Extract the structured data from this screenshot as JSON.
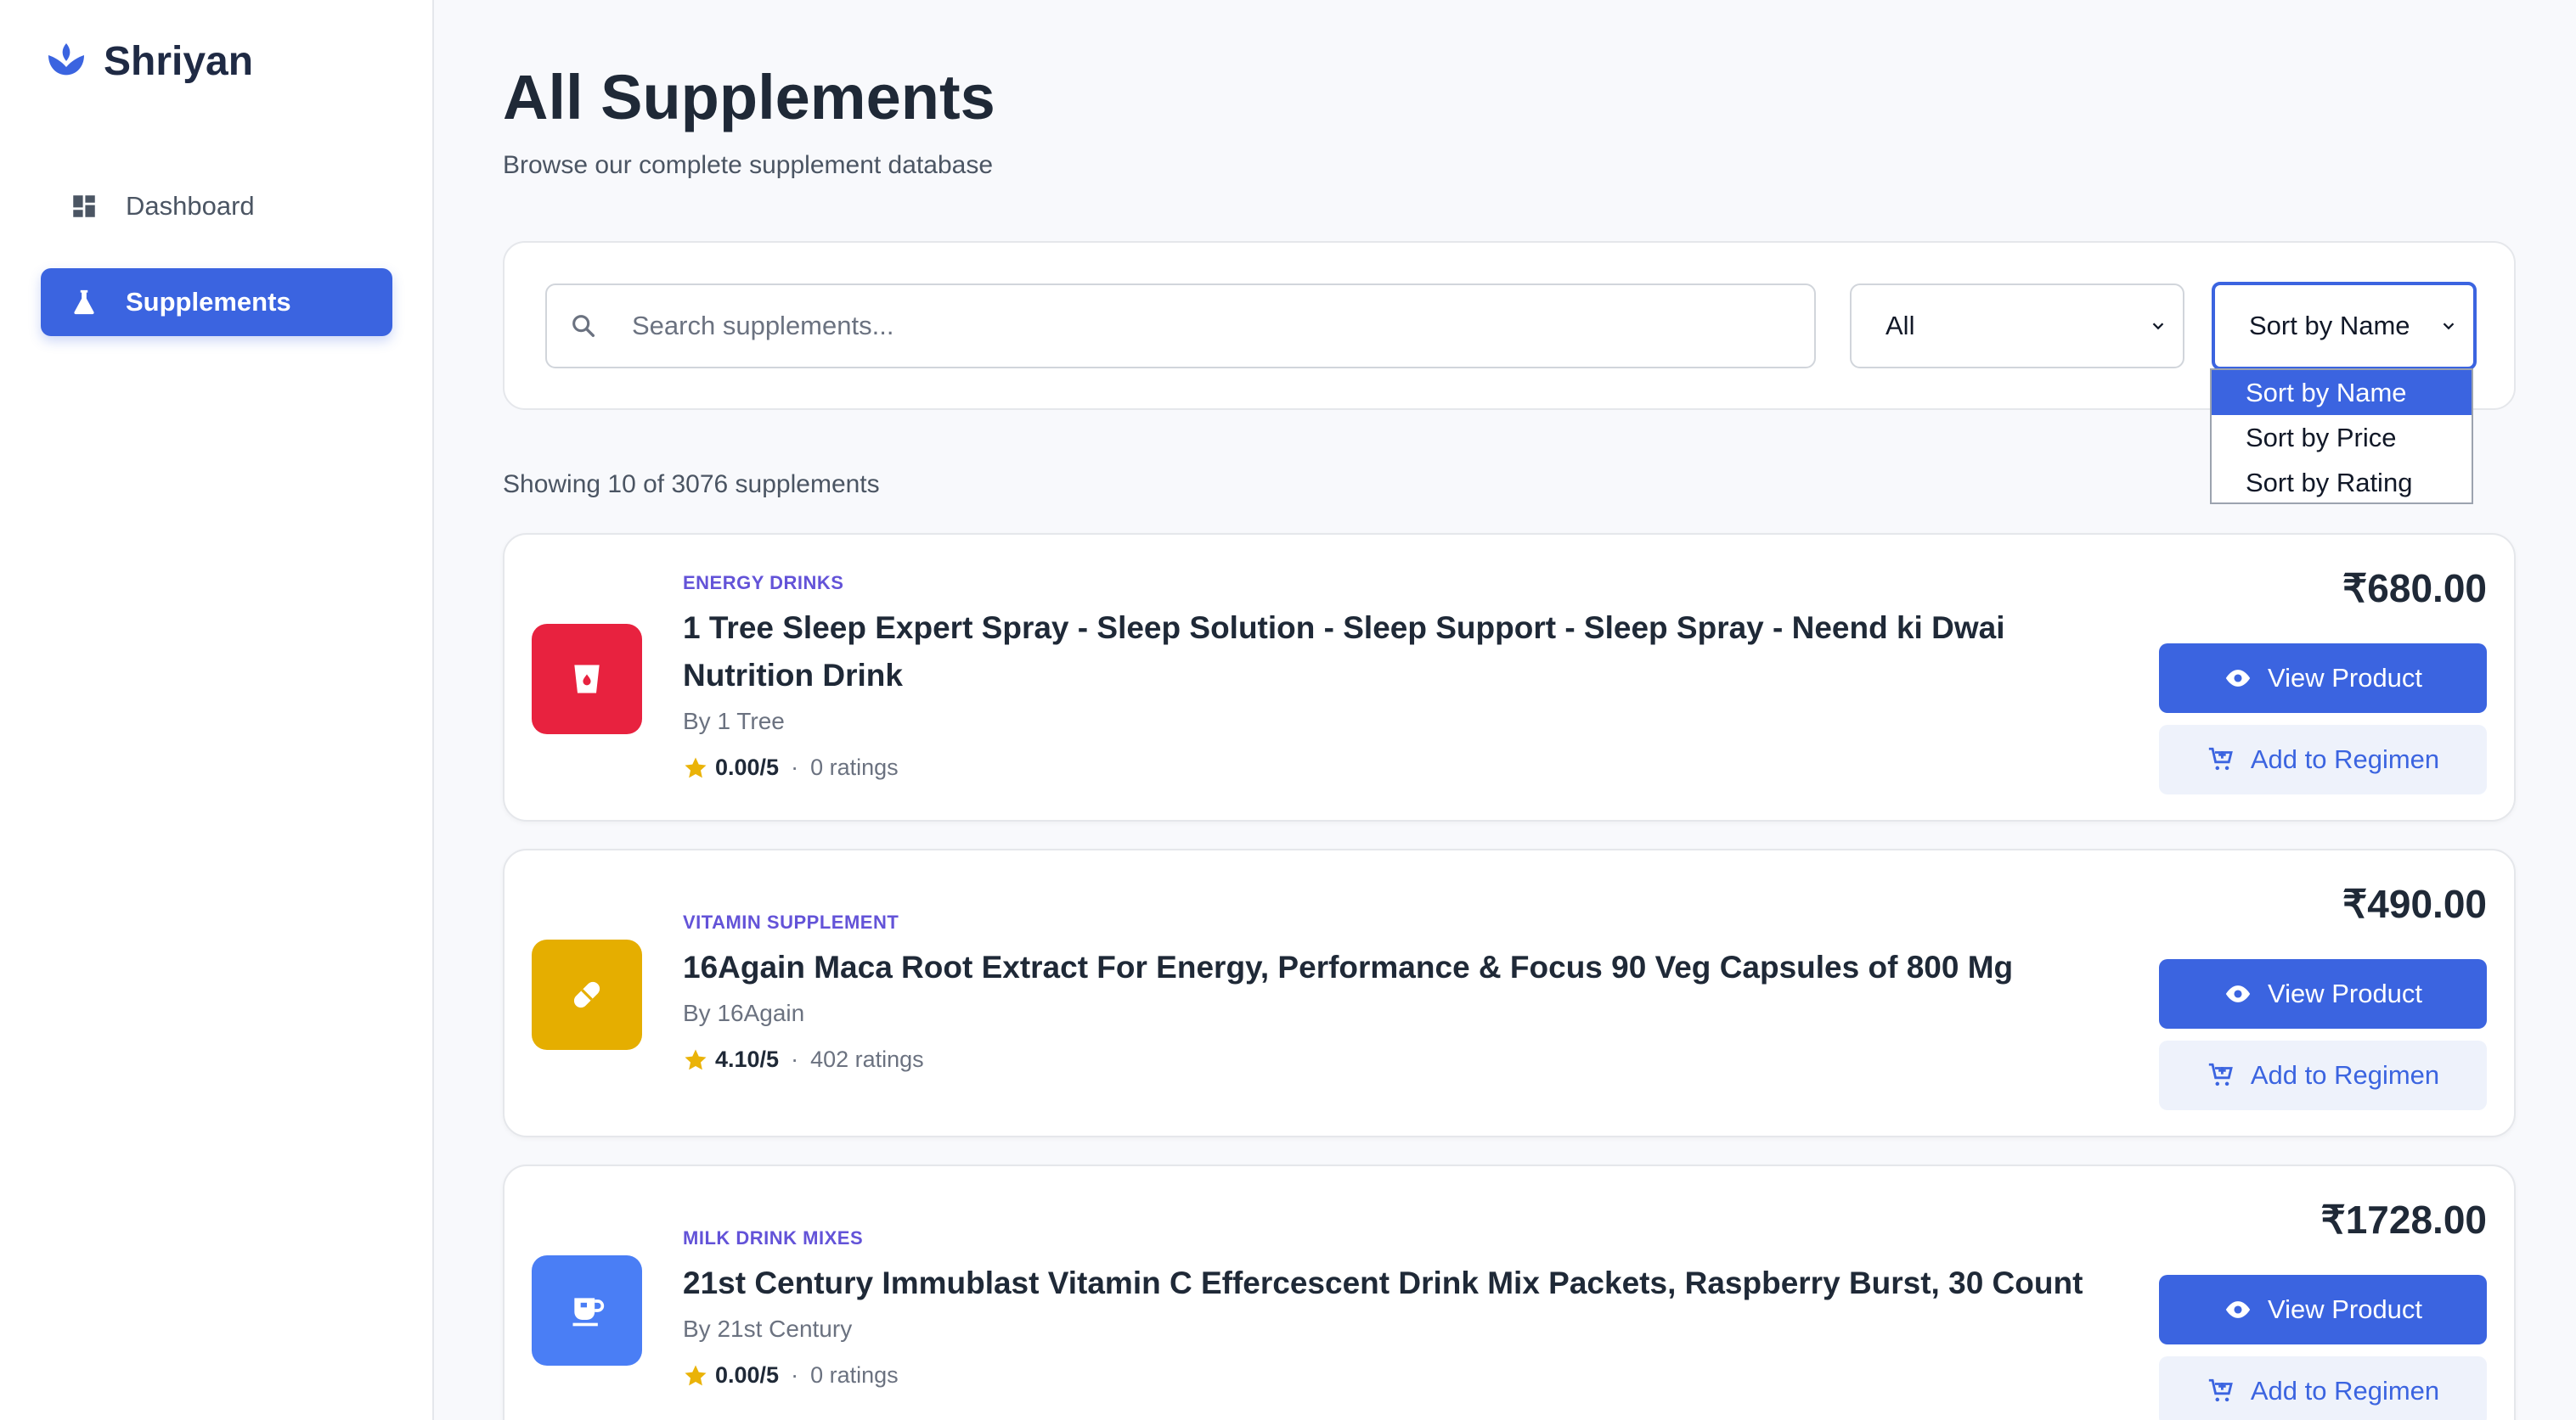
{
  "brand": {
    "name": "Shriyan",
    "icon": "lotus-icon",
    "color": "#3b64e0"
  },
  "sidebar": {
    "items": [
      {
        "label": "Dashboard",
        "icon": "dashboard-icon",
        "active": false
      },
      {
        "label": "Supplements",
        "icon": "flask-icon",
        "active": true
      }
    ]
  },
  "header": {
    "title": "All Supplements",
    "subtitle": "Browse our complete supplement database"
  },
  "filters": {
    "search_placeholder": "Search supplements...",
    "category_value": "All",
    "sort_value": "Sort by Name",
    "sort_options": [
      "Sort by Name",
      "Sort by Price",
      "Sort by Rating"
    ],
    "sort_selected_index": 0
  },
  "results": {
    "count_text": "Showing 10 of 3076 supplements"
  },
  "products": [
    {
      "category": "ENERGY DRINKS",
      "name": "1 Tree Sleep Expert Spray - Sleep Solution - Sleep Support - Sleep Spray - Neend ki Dwai Nutrition Drink",
      "brand": "By 1 Tree",
      "rating": "0.00/5",
      "ratings_count": "0 ratings",
      "price": "₹680.00",
      "icon": "drink-cup-icon",
      "icon_bg": "#e8223f",
      "view_label": "View Product",
      "add_label": "Add to Regimen"
    },
    {
      "category": "VITAMIN SUPPLEMENT",
      "name": "16Again Maca Root Extract For Energy, Performance & Focus 90 Veg Capsules of 800 Mg",
      "brand": "By 16Again",
      "rating": "4.10/5",
      "ratings_count": "402 ratings",
      "price": "₹490.00",
      "icon": "capsule-icon",
      "icon_bg": "#e5ae00",
      "view_label": "View Product",
      "add_label": "Add to Regimen"
    },
    {
      "category": "MILK DRINK MIXES",
      "name": "21st Century Immublast Vitamin C Effercescent Drink Mix Packets, Raspberry Burst, 30 Count",
      "brand": "By 21st Century",
      "rating": "0.00/5",
      "ratings_count": "0 ratings",
      "price": "₹1728.00",
      "icon": "mug-icon",
      "icon_bg": "#4a7ef5",
      "view_label": "View Product",
      "add_label": "Add to Regimen"
    }
  ],
  "rating_separator": "·"
}
